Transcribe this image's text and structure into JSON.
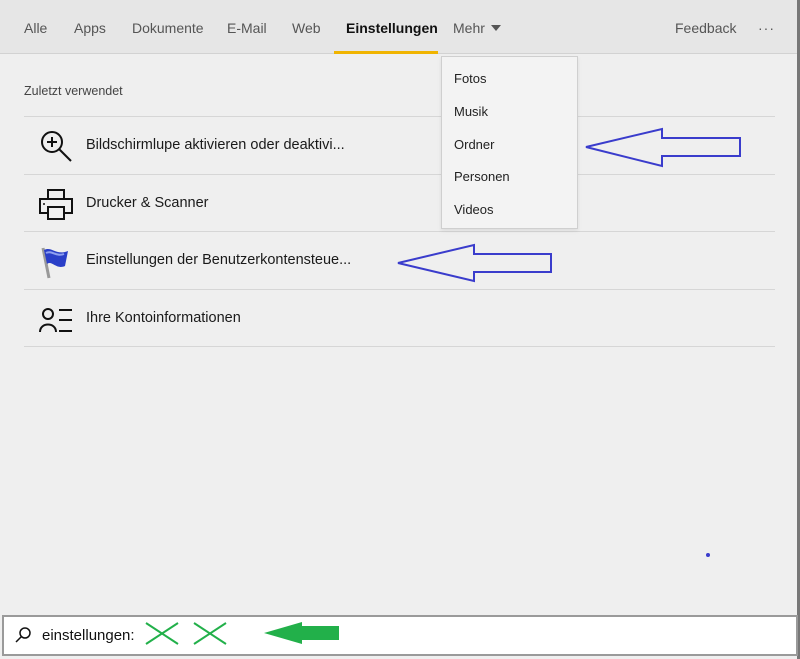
{
  "tabs": [
    {
      "label": "Alle"
    },
    {
      "label": "Apps"
    },
    {
      "label": "Dokumente"
    },
    {
      "label": "E-Mail"
    },
    {
      "label": "Web"
    },
    {
      "label": "Einstellungen",
      "active": true
    },
    {
      "label": "Mehr"
    }
  ],
  "header": {
    "feedback": "Feedback",
    "more": "···"
  },
  "section_title": "Zuletzt verwendet",
  "results": [
    {
      "label": "Bildschirmlupe aktivieren oder deaktivi...",
      "icon": "magnifier-plus-icon"
    },
    {
      "label": "Drucker & Scanner",
      "icon": "printer-icon"
    },
    {
      "label": "Einstellungen der Benutzerkontensteue...",
      "icon": "uac-flag-icon"
    },
    {
      "label": "Ihre Kontoinformationen",
      "icon": "person-list-icon"
    }
  ],
  "dropdown": [
    "Fotos",
    "Musik",
    "Ordner",
    "Personen",
    "Videos"
  ],
  "search": {
    "value": "einstellungen:",
    "icon": "search-icon"
  },
  "colors": {
    "accent": "#f0b400",
    "annotation_blue": "#3a3ccc",
    "annotation_green": "#22b04a"
  }
}
